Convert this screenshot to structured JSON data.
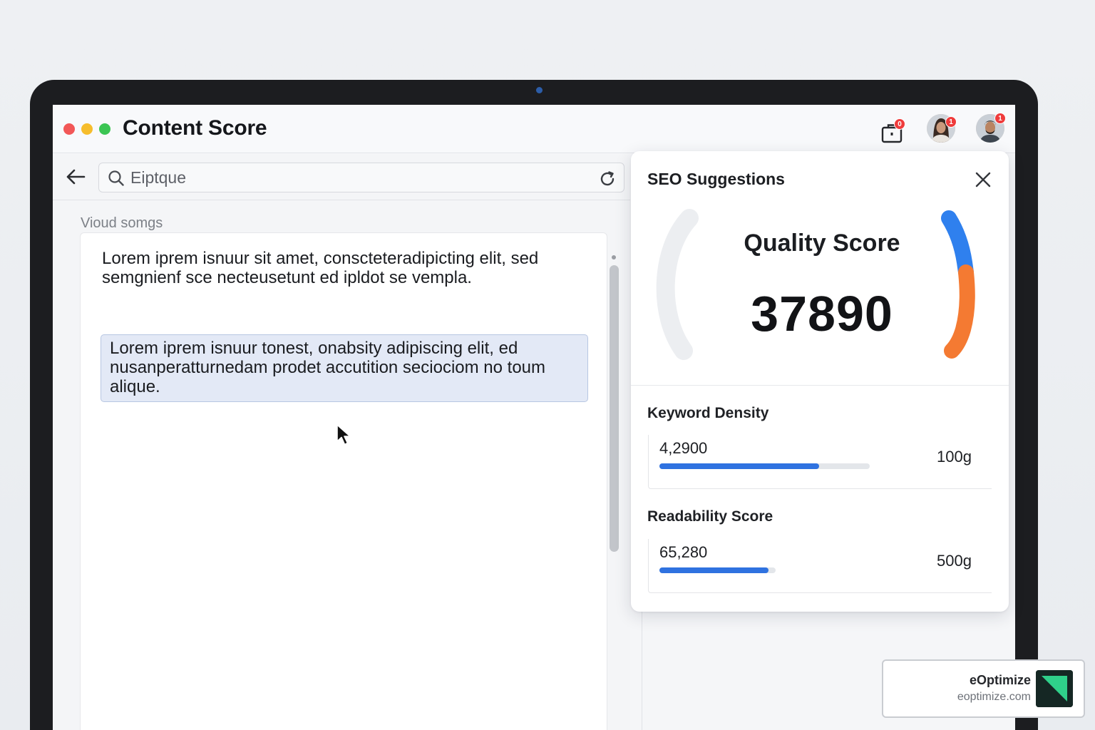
{
  "window": {
    "title": "Content Score",
    "badges": {
      "briefcase": "0",
      "avatar_1": "1",
      "avatar_2": "1"
    }
  },
  "editor": {
    "search": {
      "value": "Eiptque"
    },
    "section_label": "Vioud somgs",
    "paragraphs": [
      "Lorem iprem isnuur sit amet, conscteteradipicting elit, sed semgnienf sce necteusetunt ed ipldot se vempla.",
      "Lorem iprem isnuur tonest, onabsity adipiscing elit, ed nusanperatturnedam prodet accutition seciociom no toum alique."
    ]
  },
  "seo_panel": {
    "title": "SEO Suggestions",
    "quality": {
      "label": "Quality Score",
      "value": "37890"
    },
    "metrics": [
      {
        "title": "Keyword Density",
        "value": "4,2900",
        "target": "100g",
        "fill_fraction": 0.76
      },
      {
        "title": "Readability Score",
        "value": "65,280",
        "target": "500g",
        "fill_fraction": 0.94
      }
    ]
  },
  "brand": {
    "name": "eOptimize",
    "url": "eoptimize.com"
  },
  "colors": {
    "accent_blue": "#2f72e0",
    "gauge_blue": "#2f80ee",
    "gauge_orange": "#f47a32",
    "badge_red": "#ef3b3b",
    "brand_green": "#2fd08a"
  },
  "icons": {
    "back": "arrow-left-icon",
    "search": "search-icon",
    "refresh": "refresh-icon",
    "close": "close-icon",
    "briefcase": "briefcase-icon",
    "cursor": "mouse-cursor-icon"
  }
}
